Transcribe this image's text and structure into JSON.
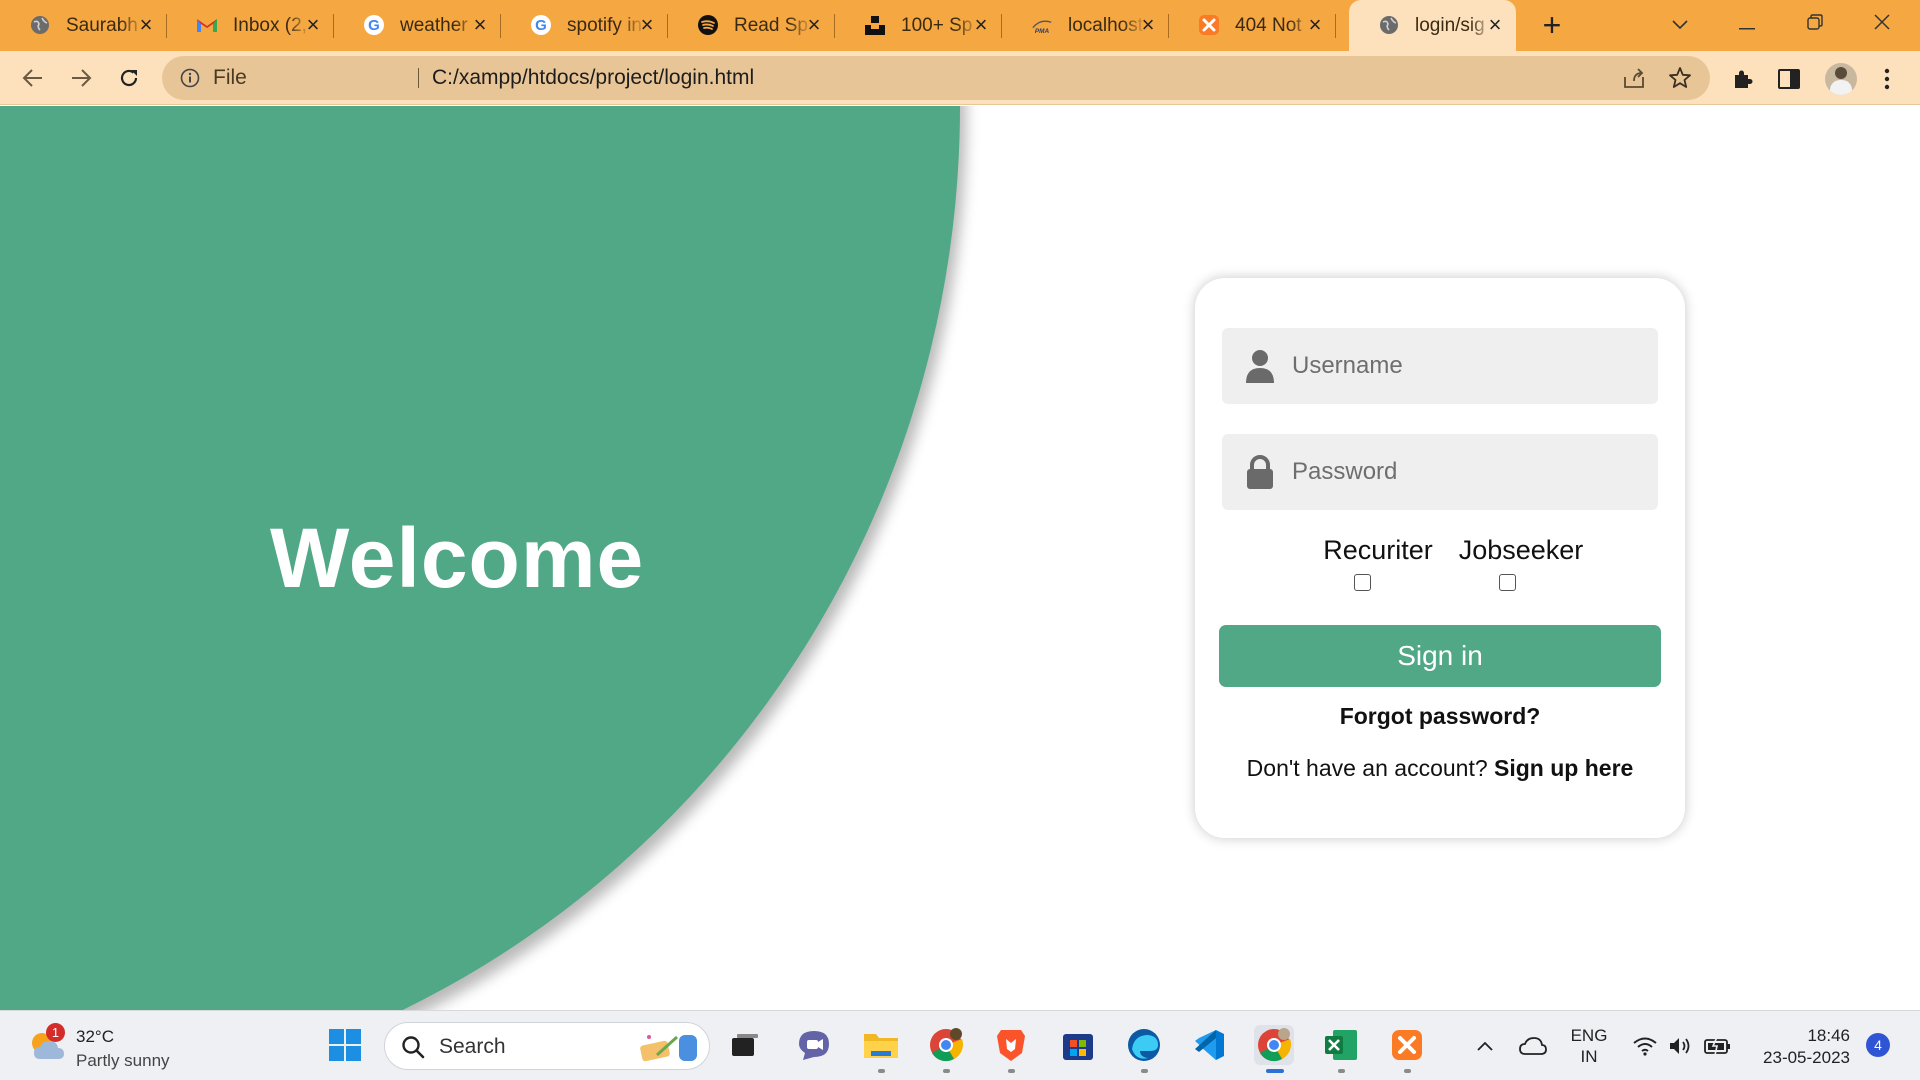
{
  "browser": {
    "tabs": [
      {
        "title": "Saurabh",
        "icon": "globe-icon"
      },
      {
        "title": "Inbox (2,",
        "icon": "gmail-icon"
      },
      {
        "title": "weather",
        "icon": "google-icon"
      },
      {
        "title": "spotify in",
        "icon": "google-icon"
      },
      {
        "title": "Read Sp",
        "icon": "spotify-icon"
      },
      {
        "title": "100+ Sp",
        "icon": "unsplash-icon"
      },
      {
        "title": "localhost",
        "icon": "phpmyadmin-icon"
      },
      {
        "title": "404 Not",
        "icon": "xampp-icon"
      },
      {
        "title": "login/sig",
        "icon": "globe-icon",
        "active": true
      }
    ],
    "new_tab_symbol": "+",
    "address": {
      "scheme_label": "File",
      "url": "C:/xampp/htdocs/project/login.html"
    },
    "accent_color": "#f5a742",
    "toolbar_color": "#fde1bd"
  },
  "page": {
    "welcome_text": "Welcome",
    "brand_color": "#50a886",
    "form": {
      "username_placeholder": "Username",
      "password_placeholder": "Password",
      "role_recruiter": "Recuriter",
      "role_jobseeker": "Jobseeker",
      "signin_label": "Sign in",
      "forgot_label": "Forgot password?",
      "signup_prompt": "Don't have an account?",
      "signup_link": "Sign up here"
    }
  },
  "taskbar": {
    "weather": {
      "temp": "32°C",
      "condition": "Partly sunny",
      "badge": "1"
    },
    "search_label": "Search",
    "language": {
      "line1": "ENG",
      "line2": "IN"
    },
    "clock": {
      "time": "18:46",
      "date": "23-05-2023"
    },
    "notification_count": "4"
  }
}
